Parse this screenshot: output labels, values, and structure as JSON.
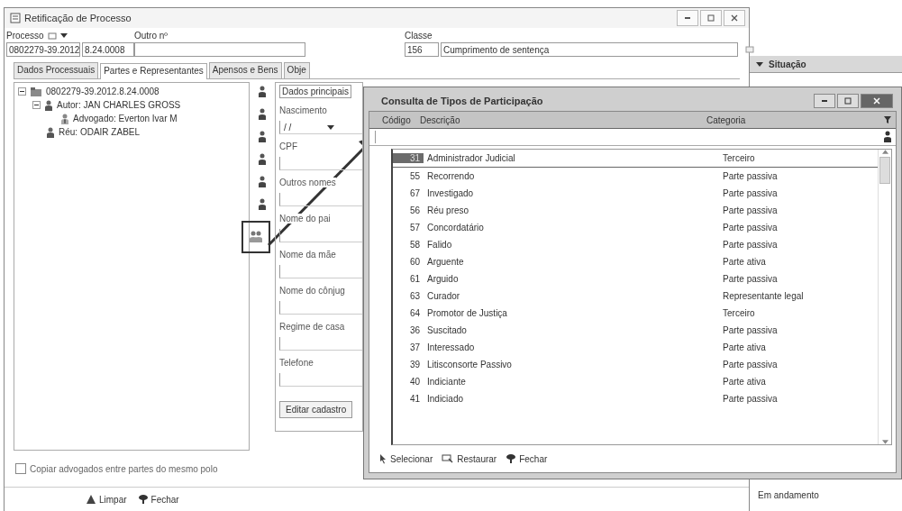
{
  "main_window": {
    "title": "Retificação de Processo",
    "processo": {
      "label": "Processo",
      "number": "0802279-39.2012",
      "suffix": "8.24.0008"
    },
    "outro_numero": {
      "label": "Outro nº"
    },
    "classe": {
      "label": "Classe",
      "code": "156",
      "name": "Cumprimento de sentença"
    },
    "tabs": [
      {
        "label": "Dados Processuais",
        "selected": false
      },
      {
        "label": "Partes e Representantes",
        "selected": true
      },
      {
        "label": "Apensos e Bens",
        "selected": false
      },
      {
        "label": "Obje",
        "selected": false
      }
    ],
    "tree": [
      {
        "label": "0802279-39.2012.8.24.0008",
        "kind": "process",
        "expanded": true,
        "children": [
          {
            "label": "Autor: JAN CHARLES GROSS",
            "kind": "person",
            "expanded": true,
            "children": [
              {
                "label": "Advogado: Everton Ivar M",
                "kind": "lawyer"
              }
            ]
          },
          {
            "label": "Réu: ODAIR ZABEL",
            "kind": "person"
          }
        ]
      }
    ],
    "copy_checkbox": {
      "label": "Copiar advogados entre partes do mesmo polo",
      "checked": false
    },
    "form": {
      "group_title": "Dados principais",
      "fields": [
        {
          "label": "Nascimento",
          "value": "/ /",
          "kind": "date"
        },
        {
          "label": "CPF",
          "kind": "text"
        },
        {
          "label": "Outros nomes",
          "kind": "text"
        },
        {
          "label": "Nome do pai",
          "kind": "text"
        },
        {
          "label": "Nome da mãe",
          "kind": "text"
        },
        {
          "label": "Nome do cônjug",
          "kind": "text"
        },
        {
          "label": "Regime de casa",
          "kind": "text"
        },
        {
          "label": "Telefone",
          "kind": "text"
        }
      ],
      "edit_button": "Editar cadastro"
    },
    "bottom_buttons": [
      "Limpar",
      "Fechar"
    ]
  },
  "background_window": {
    "column": "Situação",
    "rows": [
      "Em andamento"
    ]
  },
  "dialog": {
    "title": "Consulta de Tipos de Participação",
    "columns": [
      "Código",
      "Descrição",
      "Categoria"
    ],
    "rows": [
      {
        "code": "31",
        "description": "Administrador Judicial",
        "category": "Terceiro",
        "selected": true
      },
      {
        "code": "55",
        "description": "Recorrendo",
        "category": "Parte passiva",
        "selected": false
      },
      {
        "code": "67",
        "description": "Investigado",
        "category": "Parte passiva",
        "selected": false
      },
      {
        "code": "56",
        "description": "Réu preso",
        "category": "Parte passiva",
        "selected": false
      },
      {
        "code": "57",
        "description": "Concordatário",
        "category": "Parte passiva",
        "selected": false
      },
      {
        "code": "58",
        "description": "Falido",
        "category": "Parte passiva",
        "selected": false
      },
      {
        "code": "60",
        "description": "Arguente",
        "category": "Parte ativa",
        "selected": false
      },
      {
        "code": "61",
        "description": "Arguido",
        "category": "Parte passiva",
        "selected": false
      },
      {
        "code": "63",
        "description": "Curador",
        "category": "Representante legal",
        "selected": false
      },
      {
        "code": "64",
        "description": "Promotor de Justiça",
        "category": "Terceiro",
        "selected": false
      },
      {
        "code": "36",
        "description": "Suscitado",
        "category": "Parte passiva",
        "selected": false
      },
      {
        "code": "37",
        "description": "Interessado",
        "category": "Parte ativa",
        "selected": false
      },
      {
        "code": "39",
        "description": "Litisconsorte Passivo",
        "category": "Parte passiva",
        "selected": false
      },
      {
        "code": "40",
        "description": "Indiciante",
        "category": "Parte ativa",
        "selected": false
      },
      {
        "code": "41",
        "description": "Indiciado",
        "category": "Parte passiva",
        "selected": false
      }
    ],
    "buttons": [
      "Selecionar",
      "Restaurar",
      "Fechar"
    ]
  }
}
